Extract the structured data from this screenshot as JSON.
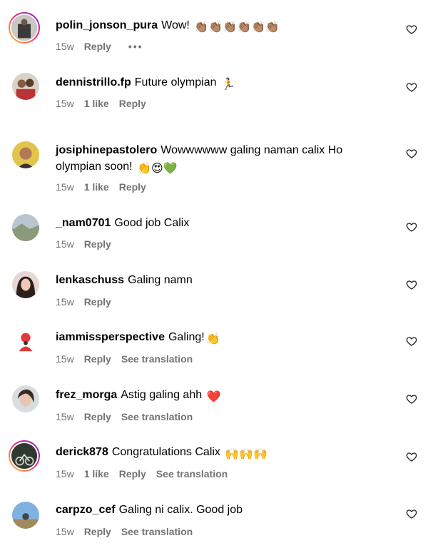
{
  "comments": [
    {
      "username": "polin_jonson_pura",
      "text": "Wow!",
      "emoji": "👏🏽👏🏽👏🏽👏🏽👏🏽👏🏽",
      "time": "15w",
      "likes": "",
      "reply": "Reply",
      "translate": "",
      "more": "•••"
    },
    {
      "username": "dennistrillo.fp",
      "text": "Future olympian",
      "emoji": "🏃",
      "time": "15w",
      "likes": "1 like",
      "reply": "Reply",
      "translate": ""
    },
    {
      "username": "josiphinepastolero",
      "text": "Wowwwwww galing naman calix Ho olympian soon!",
      "emoji": "👏😍💚",
      "time": "15w",
      "likes": "1 like",
      "reply": "Reply",
      "translate": ""
    },
    {
      "username": "_nam0701",
      "text": "Good job Calix",
      "emoji": "",
      "time": "15w",
      "likes": "",
      "reply": "Reply",
      "translate": ""
    },
    {
      "username": "lenkaschuss",
      "text": "Galing namn",
      "emoji": "",
      "time": "15w",
      "likes": "",
      "reply": "Reply",
      "translate": ""
    },
    {
      "username": "iammissperspective",
      "text": "Galing!",
      "emoji": "👏",
      "time": "15w",
      "likes": "",
      "reply": "Reply",
      "translate": "See translation"
    },
    {
      "username": "frez_morga",
      "text": "Astig galing ahh",
      "emoji": "❤️",
      "time": "15w",
      "likes": "",
      "reply": "Reply",
      "translate": "See translation"
    },
    {
      "username": "derick878",
      "text": "Congratulations Calix",
      "emoji": "🙌🙌🙌",
      "time": "15w",
      "likes": "1 like",
      "reply": "Reply",
      "translate": "See translation"
    },
    {
      "username": "carpzo_cef",
      "text": "Galing ni calix. Good job",
      "emoji": "",
      "time": "15w",
      "likes": "",
      "reply": "Reply",
      "translate": "See translation"
    }
  ]
}
